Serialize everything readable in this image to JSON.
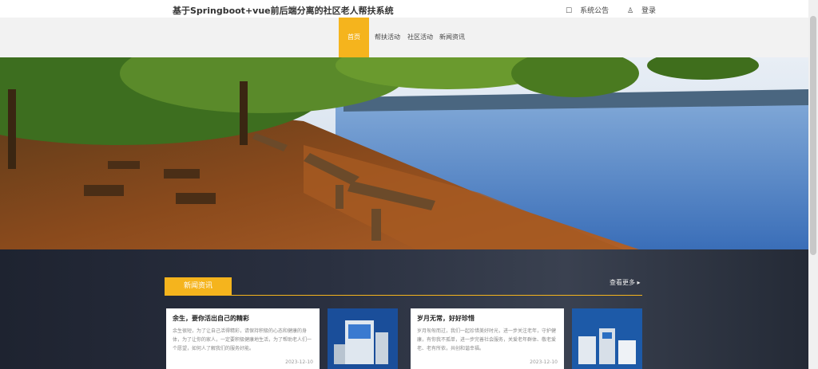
{
  "header": {
    "site_title": "基于Springboot+vue前后端分离的社区老人帮扶系统",
    "announcement_label": "系统公告",
    "login_label": "登录"
  },
  "nav": {
    "items": [
      {
        "label": "首页"
      },
      {
        "label": "帮扶活动"
      },
      {
        "label": "社区活动"
      },
      {
        "label": "新闻资讯"
      }
    ]
  },
  "news": {
    "section_title": "新闻资讯",
    "more_label": "查看更多",
    "cards": [
      {
        "title": "余生，要你活出自己的精彩",
        "body": "余生很短，为了让自己活得精彩，请保持积极的心态和健康的身体，为了让你的家人，一定要积极健康地生活，为了帮助老人们一个愿望，如何人了解我们的服务好能。",
        "date": "2023-12-10"
      },
      {
        "title": "岁月无常，好好珍惜",
        "body": "岁月匆匆而过，我们一起珍惜美好时光，进一步关注老年，守护健康，有你我不孤单，进一步完善社会服务，关爱老年群体、敬老爱老、老有所依，共创和谐幸福。",
        "date": "2023-12-10"
      }
    ]
  },
  "colors": {
    "accent": "#f5b41d"
  }
}
